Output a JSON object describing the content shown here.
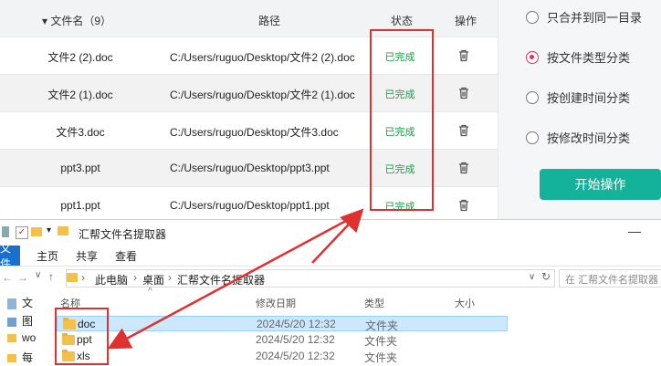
{
  "table": {
    "header": {
      "name": "▾ 文件名（9）",
      "path": "路径",
      "status": "状态",
      "op": "操作"
    },
    "rows": [
      {
        "name": "文件2 (2).doc",
        "path": "C:/Users/ruguo/Desktop/文件2 (2).doc",
        "status": "已完成"
      },
      {
        "name": "文件2 (1).doc",
        "path": "C:/Users/ruguo/Desktop/文件2 (1).doc",
        "status": "已完成"
      },
      {
        "name": "文件3.doc",
        "path": "C:/Users/ruguo/Desktop/文件3.doc",
        "status": "已完成"
      },
      {
        "name": "ppt3.ppt",
        "path": "C:/Users/ruguo/Desktop/ppt3.ppt",
        "status": "已完成"
      },
      {
        "name": "ppt1.ppt",
        "path": "C:/Users/ruguo/Desktop/ppt1.ppt",
        "status": "已完成"
      }
    ],
    "row_icon": "trash-icon"
  },
  "options": {
    "items": [
      {
        "label": "只合并到同一目录",
        "selected": false
      },
      {
        "label": "按文件类型分类",
        "selected": true
      },
      {
        "label": "按创建时间分类",
        "selected": false
      },
      {
        "label": "按修改时间分类",
        "selected": false
      }
    ],
    "start_label": "开始操作",
    "accent": "#14b29a",
    "radio_selected_color": "#e03155"
  },
  "explorer": {
    "title": "汇帮文件名提取器",
    "tabs": {
      "file": "文件",
      "home": "主页",
      "share": "共享",
      "view": "查看"
    },
    "breadcrumb": {
      "pc": "此电脑",
      "desktop": "桌面",
      "folder": "汇帮文件名提取器"
    },
    "search_placeholder": "在 汇帮文件名提取器",
    "nav": {
      "item1": "文",
      "item2": "图",
      "item3": "wo",
      "item4": "每"
    },
    "columns": {
      "name": "名称",
      "date": "修改日期",
      "type": "类型",
      "size": "大小"
    },
    "files": [
      {
        "name": "doc",
        "date": "2024/5/20 12:32",
        "type": "文件夹"
      },
      {
        "name": "ppt",
        "date": "2024/5/20 12:32",
        "type": "文件夹"
      },
      {
        "name": "xls",
        "date": "2024/5/20 12:32",
        "type": "文件夹"
      }
    ]
  },
  "colors": {
    "status_done": "#1a9b45",
    "highlight": "#e03131",
    "selected_row": "#cce8ff"
  }
}
